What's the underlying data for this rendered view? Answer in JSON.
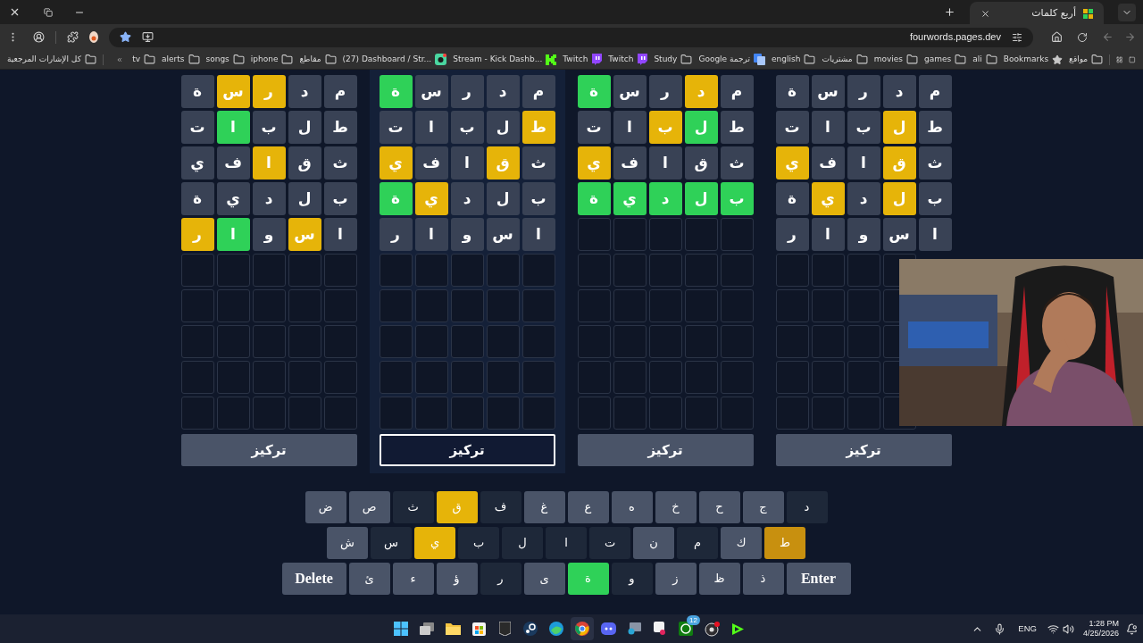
{
  "browser": {
    "tab_title": "أربع كلمات",
    "url": "fourwords.pages.dev",
    "all_bookmarks": "كل الإشارات المرجعية",
    "bookmarks": [
      {
        "label": "مواقع",
        "kind": "folder"
      },
      {
        "label": "Bookmarks",
        "kind": "star"
      },
      {
        "label": "ali",
        "kind": "folder"
      },
      {
        "label": "games",
        "kind": "folder"
      },
      {
        "label": "movies",
        "kind": "folder"
      },
      {
        "label": "مشتريات",
        "kind": "folder"
      },
      {
        "label": "english",
        "kind": "folder"
      },
      {
        "label": "Google ترجمة",
        "kind": "translate"
      },
      {
        "label": "Study",
        "kind": "folder"
      },
      {
        "label": "Twitch",
        "kind": "twitch"
      },
      {
        "label": "Twitch",
        "kind": "twitch"
      },
      {
        "label": "Stream - Kick Dashb...",
        "kind": "kick"
      },
      {
        "label": "(27) Dashboard / Str...",
        "kind": "dashboard"
      },
      {
        "label": "مقاطع",
        "kind": "folder"
      },
      {
        "label": "iphone",
        "kind": "folder"
      },
      {
        "label": "songs",
        "kind": "folder"
      },
      {
        "label": "alerts",
        "kind": "folder"
      },
      {
        "label": "tv",
        "kind": "folder"
      }
    ]
  },
  "boards": [
    {
      "selected": false,
      "focus_button": "تركيز",
      "rows": [
        [
          {
            "letter": "م",
            "color": "#394255"
          },
          {
            "letter": "د",
            "color": "#394255"
          },
          {
            "letter": "ر",
            "color": "#394255"
          },
          {
            "letter": "س",
            "color": "#394255"
          },
          {
            "letter": "ة",
            "color": "#394255"
          }
        ],
        [
          {
            "letter": "ط",
            "color": "#394255"
          },
          {
            "letter": "ل",
            "color": "#e6b409"
          },
          {
            "letter": "ب",
            "color": "#394255"
          },
          {
            "letter": "ا",
            "color": "#394255"
          },
          {
            "letter": "ت",
            "color": "#394255"
          }
        ],
        [
          {
            "letter": "ث",
            "color": "#394255"
          },
          {
            "letter": "ق",
            "color": "#e6b409"
          },
          {
            "letter": "ا",
            "color": "#394255"
          },
          {
            "letter": "ف",
            "color": "#394255"
          },
          {
            "letter": "ي",
            "color": "#e6b409"
          }
        ],
        [
          {
            "letter": "ب",
            "color": "#394255"
          },
          {
            "letter": "ل",
            "color": "#e6b409"
          },
          {
            "letter": "د",
            "color": "#394255"
          },
          {
            "letter": "ي",
            "color": "#e6b409"
          },
          {
            "letter": "ة",
            "color": "#394255"
          }
        ],
        [
          {
            "letter": "ا",
            "color": "#394255"
          },
          {
            "letter": "س",
            "color": "#394255"
          },
          {
            "letter": "و",
            "color": "#394255"
          },
          {
            "letter": "ا",
            "color": "#394255"
          },
          {
            "letter": "ر",
            "color": "#394255"
          }
        ]
      ]
    },
    {
      "selected": false,
      "focus_button": "تركيز",
      "rows": [
        [
          {
            "letter": "م",
            "color": "#394255"
          },
          {
            "letter": "د",
            "color": "#e6b409"
          },
          {
            "letter": "ر",
            "color": "#394255"
          },
          {
            "letter": "س",
            "color": "#394255"
          },
          {
            "letter": "ة",
            "color": "#2fd158"
          }
        ],
        [
          {
            "letter": "ط",
            "color": "#394255"
          },
          {
            "letter": "ل",
            "color": "#2fd158"
          },
          {
            "letter": "ب",
            "color": "#e6b409"
          },
          {
            "letter": "ا",
            "color": "#394255"
          },
          {
            "letter": "ت",
            "color": "#394255"
          }
        ],
        [
          {
            "letter": "ث",
            "color": "#394255"
          },
          {
            "letter": "ق",
            "color": "#394255"
          },
          {
            "letter": "ا",
            "color": "#394255"
          },
          {
            "letter": "ف",
            "color": "#394255"
          },
          {
            "letter": "ي",
            "color": "#e6b409"
          }
        ],
        [
          {
            "letter": "ب",
            "color": "#2fd158"
          },
          {
            "letter": "ل",
            "color": "#2fd158"
          },
          {
            "letter": "د",
            "color": "#2fd158"
          },
          {
            "letter": "ي",
            "color": "#2fd158"
          },
          {
            "letter": "ة",
            "color": "#2fd158"
          }
        ]
      ]
    },
    {
      "selected": true,
      "focus_button": "تركيز",
      "rows": [
        [
          {
            "letter": "م",
            "color": "#394255"
          },
          {
            "letter": "د",
            "color": "#394255"
          },
          {
            "letter": "ر",
            "color": "#394255"
          },
          {
            "letter": "س",
            "color": "#394255"
          },
          {
            "letter": "ة",
            "color": "#2fd158"
          }
        ],
        [
          {
            "letter": "ط",
            "color": "#e6b409"
          },
          {
            "letter": "ل",
            "color": "#394255"
          },
          {
            "letter": "ب",
            "color": "#394255"
          },
          {
            "letter": "ا",
            "color": "#394255"
          },
          {
            "letter": "ت",
            "color": "#394255"
          }
        ],
        [
          {
            "letter": "ث",
            "color": "#394255"
          },
          {
            "letter": "ق",
            "color": "#e6b409"
          },
          {
            "letter": "ا",
            "color": "#394255"
          },
          {
            "letter": "ف",
            "color": "#394255"
          },
          {
            "letter": "ي",
            "color": "#e6b409"
          }
        ],
        [
          {
            "letter": "ب",
            "color": "#394255"
          },
          {
            "letter": "ل",
            "color": "#394255"
          },
          {
            "letter": "د",
            "color": "#394255"
          },
          {
            "letter": "ي",
            "color": "#e6b409"
          },
          {
            "letter": "ة",
            "color": "#2fd158"
          }
        ],
        [
          {
            "letter": "ا",
            "color": "#394255"
          },
          {
            "letter": "س",
            "color": "#394255"
          },
          {
            "letter": "و",
            "color": "#394255"
          },
          {
            "letter": "ا",
            "color": "#394255"
          },
          {
            "letter": "ر",
            "color": "#394255"
          }
        ]
      ]
    },
    {
      "selected": false,
      "focus_button": "تركيز",
      "rows": [
        [
          {
            "letter": "م",
            "color": "#394255"
          },
          {
            "letter": "د",
            "color": "#394255"
          },
          {
            "letter": "ر",
            "color": "#e6b409"
          },
          {
            "letter": "س",
            "color": "#e6b409"
          },
          {
            "letter": "ة",
            "color": "#394255"
          }
        ],
        [
          {
            "letter": "ط",
            "color": "#394255"
          },
          {
            "letter": "ل",
            "color": "#394255"
          },
          {
            "letter": "ب",
            "color": "#394255"
          },
          {
            "letter": "ا",
            "color": "#2fd158"
          },
          {
            "letter": "ت",
            "color": "#394255"
          }
        ],
        [
          {
            "letter": "ث",
            "color": "#394255"
          },
          {
            "letter": "ق",
            "color": "#394255"
          },
          {
            "letter": "ا",
            "color": "#e6b409"
          },
          {
            "letter": "ف",
            "color": "#394255"
          },
          {
            "letter": "ي",
            "color": "#394255"
          }
        ],
        [
          {
            "letter": "ب",
            "color": "#394255"
          },
          {
            "letter": "ل",
            "color": "#394255"
          },
          {
            "letter": "د",
            "color": "#394255"
          },
          {
            "letter": "ي",
            "color": "#394255"
          },
          {
            "letter": "ة",
            "color": "#394255"
          }
        ],
        [
          {
            "letter": "ا",
            "color": "#394255"
          },
          {
            "letter": "س",
            "color": "#e6b409"
          },
          {
            "letter": "و",
            "color": "#394255"
          },
          {
            "letter": "ا",
            "color": "#2fd158"
          },
          {
            "letter": "ر",
            "color": "#e6b409"
          }
        ]
      ]
    }
  ],
  "keyboard": [
    [
      {
        "label": "د",
        "color": "#1e2839"
      },
      {
        "label": "ج",
        "color": "#4a5468"
      },
      {
        "label": "ح",
        "color": "#4a5468"
      },
      {
        "label": "خ",
        "color": "#4a5468"
      },
      {
        "label": "ه",
        "color": "#4a5468"
      },
      {
        "label": "ع",
        "color": "#4a5468"
      },
      {
        "label": "غ",
        "color": "#4a5468"
      },
      {
        "label": "ف",
        "color": "#1e2839"
      },
      {
        "label": "ق",
        "color": "#e6b409"
      },
      {
        "label": "ث",
        "color": "#1e2839"
      },
      {
        "label": "ص",
        "color": "#4a5468"
      },
      {
        "label": "ض",
        "color": "#4a5468"
      }
    ],
    [
      {
        "label": "ط",
        "color": "#c8900f"
      },
      {
        "label": "ك",
        "color": "#4a5468"
      },
      {
        "label": "م",
        "color": "#1e2839"
      },
      {
        "label": "ن",
        "color": "#4a5468"
      },
      {
        "label": "ت",
        "color": "#1e2839"
      },
      {
        "label": "ا",
        "color": "#1e2839"
      },
      {
        "label": "ل",
        "color": "#1e2839"
      },
      {
        "label": "ب",
        "color": "#1e2839"
      },
      {
        "label": "ي",
        "color": "#e6b409"
      },
      {
        "label": "س",
        "color": "#1e2839"
      },
      {
        "label": "ش",
        "color": "#4a5468"
      }
    ],
    [
      {
        "label": "Enter",
        "color": "#4a5468",
        "kind": "action"
      },
      {
        "label": "ذ",
        "color": "#4a5468"
      },
      {
        "label": "ظ",
        "color": "#4a5468"
      },
      {
        "label": "ز",
        "color": "#4a5468"
      },
      {
        "label": "و",
        "color": "#1e2839"
      },
      {
        "label": "ة",
        "color": "#2fd158"
      },
      {
        "label": "ى",
        "color": "#4a5468"
      },
      {
        "label": "ر",
        "color": "#1e2839"
      },
      {
        "label": "ؤ",
        "color": "#4a5468"
      },
      {
        "label": "ء",
        "color": "#4a5468"
      },
      {
        "label": "ئ",
        "color": "#4a5468"
      },
      {
        "label": "Delete",
        "color": "#4a5468",
        "kind": "action"
      }
    ]
  ],
  "taskbar": {
    "badge": "12",
    "language": "ENG",
    "time": "1:28 PM",
    "date": "4/25/2026"
  }
}
